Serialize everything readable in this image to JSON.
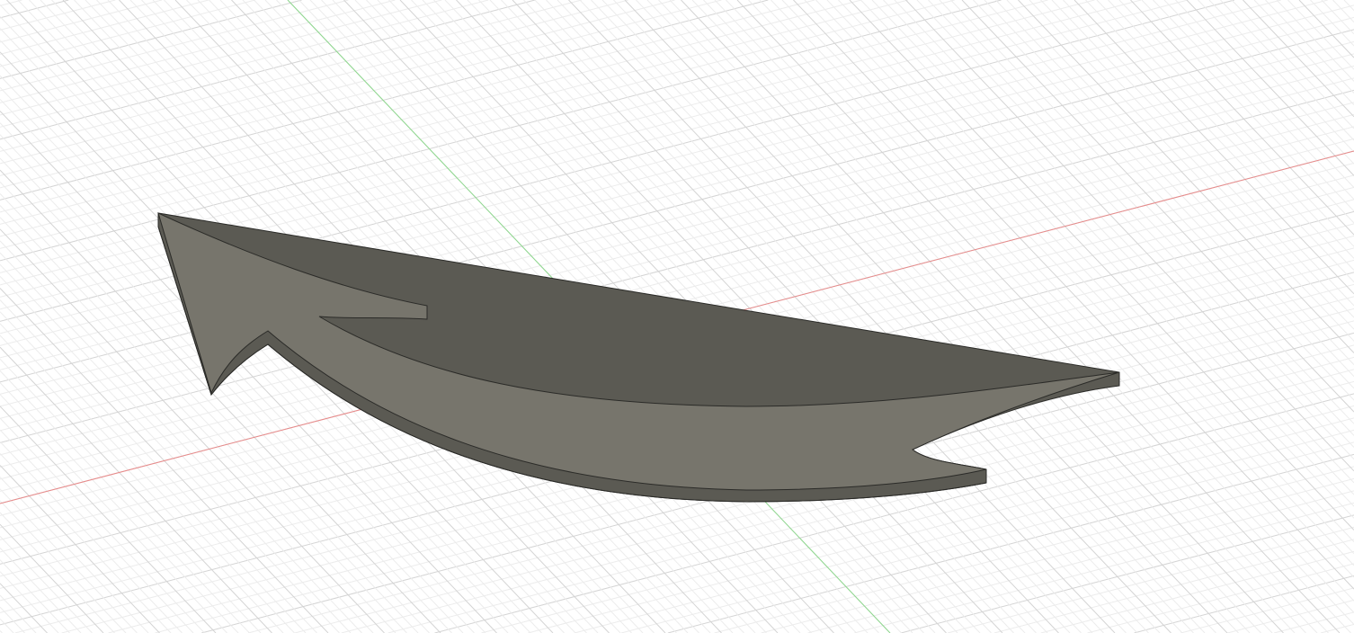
{
  "viewport": {
    "colors": {
      "background": "#ffffff",
      "grid_minor": "#ececec",
      "grid_major": "#d4d4d4",
      "x_axis": "#e88a8a",
      "y_axis": "#8fd98f",
      "body_top": "#77756c",
      "body_side": "#5b5a53",
      "edge": "#2b2b28",
      "origin": "#9a9a9a"
    }
  }
}
